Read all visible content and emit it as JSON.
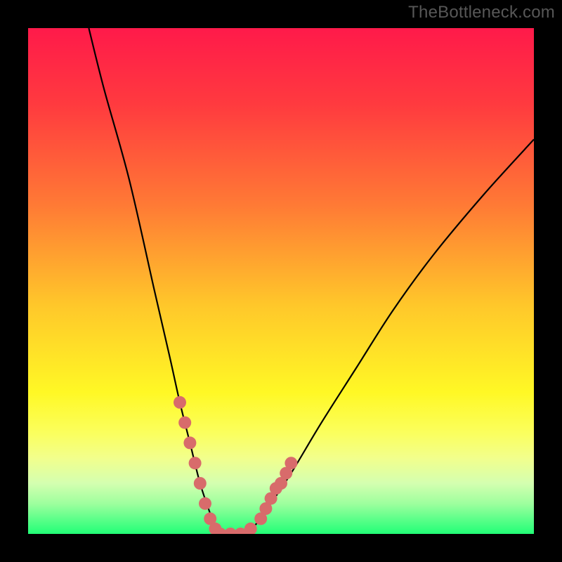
{
  "watermark": "TheBottleneck.com",
  "chart_data": {
    "type": "line",
    "title": "",
    "xlabel": "",
    "ylabel": "",
    "xlim": [
      0,
      100
    ],
    "ylim": [
      0,
      100
    ],
    "background_gradient_stops": [
      {
        "offset": 0,
        "color": "#ff1a4a"
      },
      {
        "offset": 0.15,
        "color": "#ff3a3f"
      },
      {
        "offset": 0.35,
        "color": "#ff7a35"
      },
      {
        "offset": 0.55,
        "color": "#ffc82a"
      },
      {
        "offset": 0.72,
        "color": "#fff825"
      },
      {
        "offset": 0.8,
        "color": "#fbff5d"
      },
      {
        "offset": 0.85,
        "color": "#f2ff8c"
      },
      {
        "offset": 0.9,
        "color": "#d4ffb0"
      },
      {
        "offset": 0.94,
        "color": "#9eff9e"
      },
      {
        "offset": 0.97,
        "color": "#5eff8a"
      },
      {
        "offset": 1.0,
        "color": "#22ff77"
      }
    ],
    "series": [
      {
        "name": "bottleneck-curve",
        "x": [
          12,
          15,
          20,
          25,
          28,
          30,
          32,
          34,
          36,
          37,
          38,
          40,
          42,
          44,
          46,
          48,
          52,
          58,
          65,
          72,
          80,
          90,
          100
        ],
        "y": [
          100,
          88,
          70,
          48,
          35,
          26,
          18,
          10,
          4,
          1,
          0,
          0,
          0,
          1,
          3,
          6,
          12,
          22,
          33,
          44,
          55,
          67,
          78
        ]
      }
    ],
    "markers": {
      "name": "highlight-points",
      "color": "#d86b6b",
      "points": [
        {
          "x": 30,
          "y": 26
        },
        {
          "x": 31,
          "y": 22
        },
        {
          "x": 32,
          "y": 18
        },
        {
          "x": 33,
          "y": 14
        },
        {
          "x": 34,
          "y": 10
        },
        {
          "x": 35,
          "y": 6
        },
        {
          "x": 36,
          "y": 3
        },
        {
          "x": 37,
          "y": 1
        },
        {
          "x": 38,
          "y": 0
        },
        {
          "x": 40,
          "y": 0
        },
        {
          "x": 42,
          "y": 0
        },
        {
          "x": 44,
          "y": 1
        },
        {
          "x": 46,
          "y": 3
        },
        {
          "x": 47,
          "y": 5
        },
        {
          "x": 48,
          "y": 7
        },
        {
          "x": 49,
          "y": 9
        },
        {
          "x": 50,
          "y": 10
        },
        {
          "x": 51,
          "y": 12
        },
        {
          "x": 52,
          "y": 14
        }
      ]
    }
  }
}
